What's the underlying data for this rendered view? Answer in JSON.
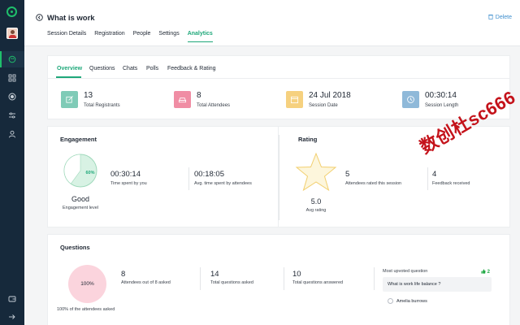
{
  "header": {
    "title": "What is work",
    "delete_label": "Delete",
    "tabs": [
      {
        "label": "Session Details"
      },
      {
        "label": "Registration"
      },
      {
        "label": "People"
      },
      {
        "label": "Settings"
      },
      {
        "label": "Analytics"
      }
    ],
    "active_tab": "Analytics"
  },
  "subtabs": {
    "items": [
      {
        "label": "Overview"
      },
      {
        "label": "Questions"
      },
      {
        "label": "Chats"
      },
      {
        "label": "Polls"
      },
      {
        "label": "Feedback & Rating"
      }
    ],
    "active": "Overview"
  },
  "stats": [
    {
      "value": "13",
      "label": "Total Registrants",
      "icon": "edit-icon",
      "color": "#7fcbb7"
    },
    {
      "value": "8",
      "label": "Total Attendees",
      "icon": "car-icon",
      "color": "#f08da4"
    },
    {
      "value": "24 Jul 2018",
      "label": "Session Date",
      "icon": "calendar-icon",
      "color": "#f6d17f"
    },
    {
      "value": "00:30:14",
      "label": "Session Length",
      "icon": "clock-icon",
      "color": "#8fb9d9"
    }
  ],
  "engagement": {
    "title": "Engagement",
    "percent_label": "60%",
    "percent": 60,
    "level": "Good",
    "level_label": "Engagement level",
    "time_you": "00:30:14",
    "time_you_label": "Time spent by you",
    "time_avg": "00:18:05",
    "time_avg_label": "Avg. time spent by attendees"
  },
  "rating": {
    "title": "Rating",
    "avg": "5.0",
    "avg_label": "Avg rating",
    "rated": "5",
    "rated_label": "Attendees rated this session",
    "feedback": "4",
    "feedback_label": "Feedback received"
  },
  "questions": {
    "title": "Questions",
    "percent_label": "100%",
    "note": "100% of the attendees asked",
    "asked": "8",
    "asked_label": "Attendees out of 8 asked",
    "total": "14",
    "total_label": "Total questions asked",
    "answered": "10",
    "answered_label": "Total questions answered",
    "most_upvoted_title": "Most upvoted question",
    "upvotes": "2",
    "top_question": "What is work life balance ?",
    "top_question_user": "Amelia burrows"
  },
  "watermark": "数创杜sc666",
  "colors": {
    "accent": "#1fa87a",
    "rail": "#16293b",
    "delete": "#3f8fce"
  }
}
